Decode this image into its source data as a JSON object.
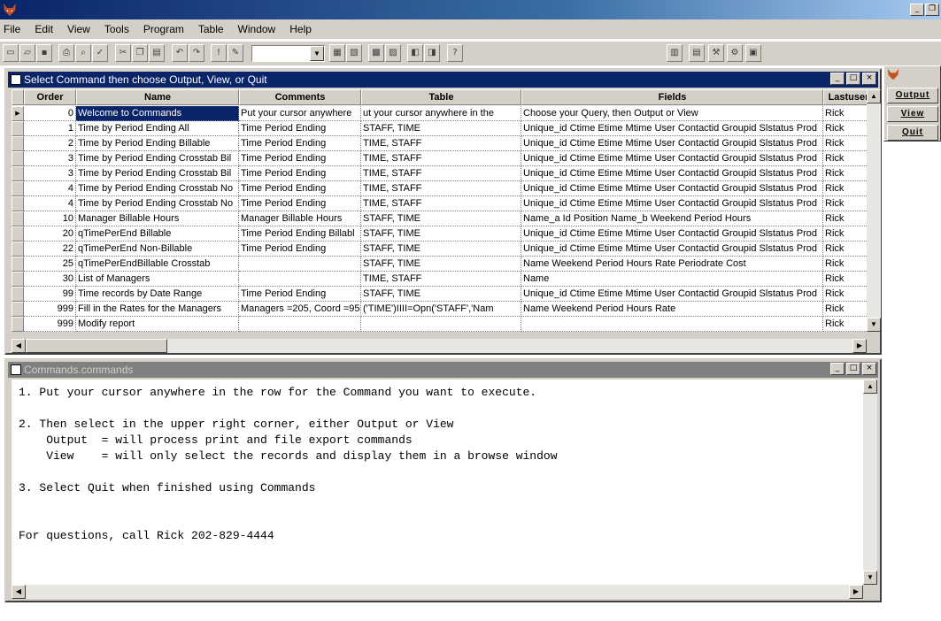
{
  "menu": [
    "File",
    "Edit",
    "View",
    "Tools",
    "Program",
    "Table",
    "Window",
    "Help"
  ],
  "app_window_buttons": [
    "_",
    "❐"
  ],
  "grid_window": {
    "title": "Select Command then choose Output, View, or Quit",
    "columns": [
      "Order",
      "Name",
      "Comments",
      "Table",
      "Fields",
      "Lastuser"
    ],
    "rows": [
      [
        "0",
        "Welcome to Commands",
        "Put your cursor anywhere",
        "ut your cursor anywhere in the",
        "Choose your Query, then Output or View",
        "Rick"
      ],
      [
        "1",
        "Time by Period Ending All",
        "Time Period Ending",
        "STAFF, TIME",
        "Unique_id Ctime Etime Mtime User Contactid Groupid Slstatus Prod",
        "Rick"
      ],
      [
        "2",
        "Time by Period Ending Billable",
        "Time Period Ending",
        "TIME, STAFF",
        "Unique_id Ctime Etime Mtime User Contactid Groupid Slstatus Prod",
        "Rick"
      ],
      [
        "3",
        "Time by Period Ending Crosstab Bil",
        "Time Period Ending",
        "TIME, STAFF",
        "Unique_id Ctime Etime Mtime User Contactid Groupid Slstatus Prod",
        "Rick"
      ],
      [
        "3",
        "Time by Period Ending Crosstab Bil",
        "Time Period Ending",
        "TIME, STAFF",
        "Unique_id Ctime Etime Mtime User Contactid Groupid Slstatus Prod",
        "Rick"
      ],
      [
        "4",
        "Time by Period Ending Crosstab No",
        "Time Period Ending",
        "TIME, STAFF",
        "Unique_id Ctime Etime Mtime User Contactid Groupid Slstatus Prod",
        "Rick"
      ],
      [
        "4",
        "Time by Period Ending Crosstab No",
        "Time Period Ending",
        "TIME, STAFF",
        "Unique_id Ctime Etime Mtime User Contactid Groupid Slstatus Prod",
        "Rick"
      ],
      [
        "10",
        "Manager Billable Hours",
        "Manager Billable Hours",
        "STAFF, TIME",
        "Name_a Id Position Name_b Weekend Period Hours",
        "Rick"
      ],
      [
        "20",
        "qTimePerEnd Billable",
        "Time Period Ending Billabl",
        "STAFF, TIME",
        "Unique_id Ctime Etime Mtime User Contactid Groupid Slstatus Prod",
        "Rick"
      ],
      [
        "22",
        "qTimePerEnd Non-Billable",
        "Time Period Ending",
        "STAFF, TIME",
        "Unique_id Ctime Etime Mtime User Contactid Groupid Slstatus Prod",
        "Rick"
      ],
      [
        "25",
        "qTimePerEndBillable Crosstab",
        "",
        "STAFF, TIME",
        "Name Weekend Period Hours Rate Periodrate Cost",
        "Rick"
      ],
      [
        "30",
        "List of Managers",
        "",
        "TIME, STAFF",
        "Name",
        "Rick"
      ],
      [
        "99",
        "Time records by Date Range",
        "Time Period Ending",
        "STAFF, TIME",
        "Unique_id Ctime Etime Mtime User Contactid Groupid Slstatus Prod",
        "Rick"
      ],
      [
        "999",
        "Fill in the Rates for the Managers",
        "Managers =205, Coord =95",
        "('TIME')IIII=Opn('STAFF','Nam",
        "Name Weekend Period Hours Rate",
        "Rick"
      ],
      [
        "999",
        "Modify report",
        "",
        "",
        "",
        "Rick"
      ]
    ]
  },
  "memo_window": {
    "title": "Commands.commands",
    "text": "1. Put your cursor anywhere in the row for the Command you want to execute.\n\n2. Then select in the upper right corner, either Output or View\n    Output  = will process print and file export commands\n    View    = will only select the records and display them in a browse window\n\n3. Select Quit when finished using Commands\n\n\nFor questions, call Rick 202-829-4444"
  },
  "side_panel": {
    "output_label": "Output",
    "view_label": "View",
    "quit_label": "Quit"
  },
  "colors": {
    "title_active": "#0a246a",
    "title_inactive": "#808080",
    "face": "#d4d0c8"
  }
}
